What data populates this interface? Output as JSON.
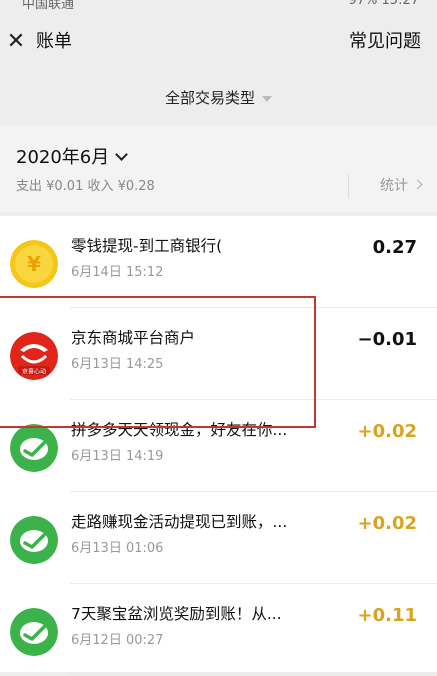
{
  "status_bar": {
    "carrier": "中国联通",
    "right": "97% 15:27"
  },
  "nav": {
    "close_glyph": "✕",
    "title": "账单",
    "right_link": "常见问题"
  },
  "filter": {
    "label": "全部交易类型"
  },
  "month": {
    "title": "2020年6月",
    "summary": "支出 ¥0.01 收入 ¥0.28",
    "stat_label": "统计"
  },
  "transactions": [
    {
      "title": "零钱提现-到工商银行(",
      "time": "6月14日 15:12",
      "amount": "0.27",
      "amount_color": "#111111",
      "icon": "coin-icon"
    },
    {
      "title": "京东商城平台商户",
      "time": "6月13日 14:25",
      "amount": "−0.01",
      "amount_color": "#111111",
      "icon": "jd-logo-icon",
      "icon_text": "京喜心动"
    },
    {
      "title": "拼多多天天领现金，好友在你...",
      "time": "6月13日 14:19",
      "amount": "+0.02",
      "amount_color": "#d9a321",
      "icon": "wechat-pay-icon"
    },
    {
      "title": "走路赚现金活动提现已到账，...",
      "time": "6月13日 01:06",
      "amount": "+0.02",
      "amount_color": "#d9a321",
      "icon": "wechat-pay-icon"
    },
    {
      "title": "7天聚宝盆浏览奖励到账！从...",
      "time": "6月12日 00:27",
      "amount": "+0.11",
      "amount_color": "#d9a321",
      "icon": "wechat-pay-icon"
    }
  ],
  "colors": {
    "income": "#d9a321",
    "highlight": "#c0392b",
    "wechat_green": "#3cb34a",
    "coin": "#f5c518"
  }
}
